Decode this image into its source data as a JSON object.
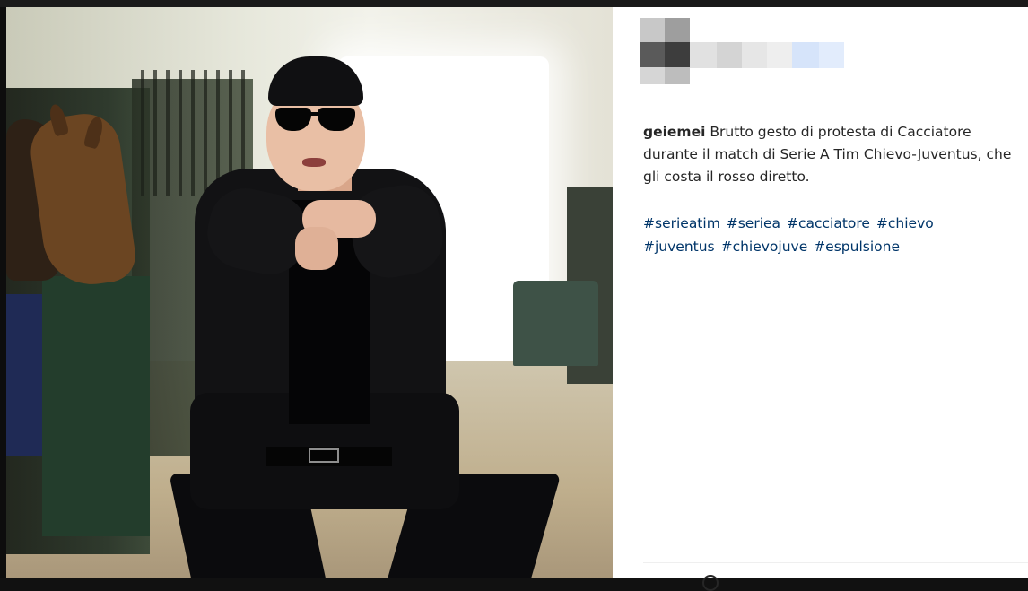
{
  "post": {
    "username": "geiemei",
    "caption": "Brutto gesto di protesta di Cacciatore durante il match di Serie A Tim Chievo-Juventus, che gli costa il rosso diretto.",
    "hashtags": [
      "#serieatim",
      "#seriea",
      "#cacciatore",
      "#chievo",
      "#juventus",
      "#chievojuve",
      "#espulsione"
    ]
  },
  "colors": {
    "caption_text": "#262626",
    "hashtag": "#003569",
    "panel_bg": "#ffffff"
  },
  "icons": {
    "avatar": "pixelated-avatar-icon",
    "account_name": "pixelated-username-redacted"
  }
}
